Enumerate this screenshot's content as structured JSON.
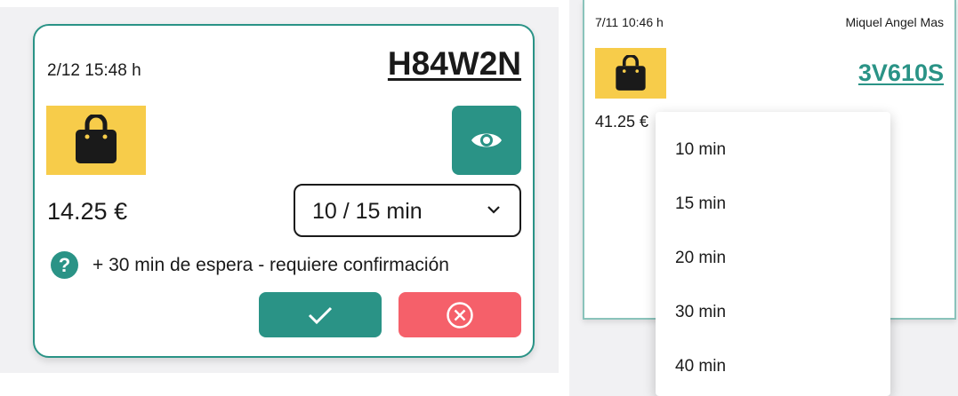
{
  "left_card": {
    "datetime": "2/12 15:48 h",
    "code": "H84W2N",
    "price": "14.25 €",
    "select_value": "10 / 15 min",
    "help_text": "+ 30 min de espera - requiere confirmación",
    "help_icon_glyph": "?"
  },
  "right_card": {
    "datetime": "7/11 10:46 h",
    "customer_name": "Miquel Angel Mas",
    "code": "3V610S",
    "price": "41.25 €"
  },
  "dropdown": {
    "options": [
      "10 min",
      "15 min",
      "20 min",
      "30 min",
      "40 min"
    ]
  },
  "icons": {
    "bag": "shopping-bag-icon",
    "eye": "eye-icon",
    "chevron": "chevron-down-icon",
    "help": "question-circle-icon",
    "check": "check-icon",
    "cancel": "cancel-circle-icon"
  },
  "colors": {
    "teal": "#2a9386",
    "red": "#f5606a",
    "yellow": "#f7cc4a",
    "text": "#1a1a1a"
  }
}
